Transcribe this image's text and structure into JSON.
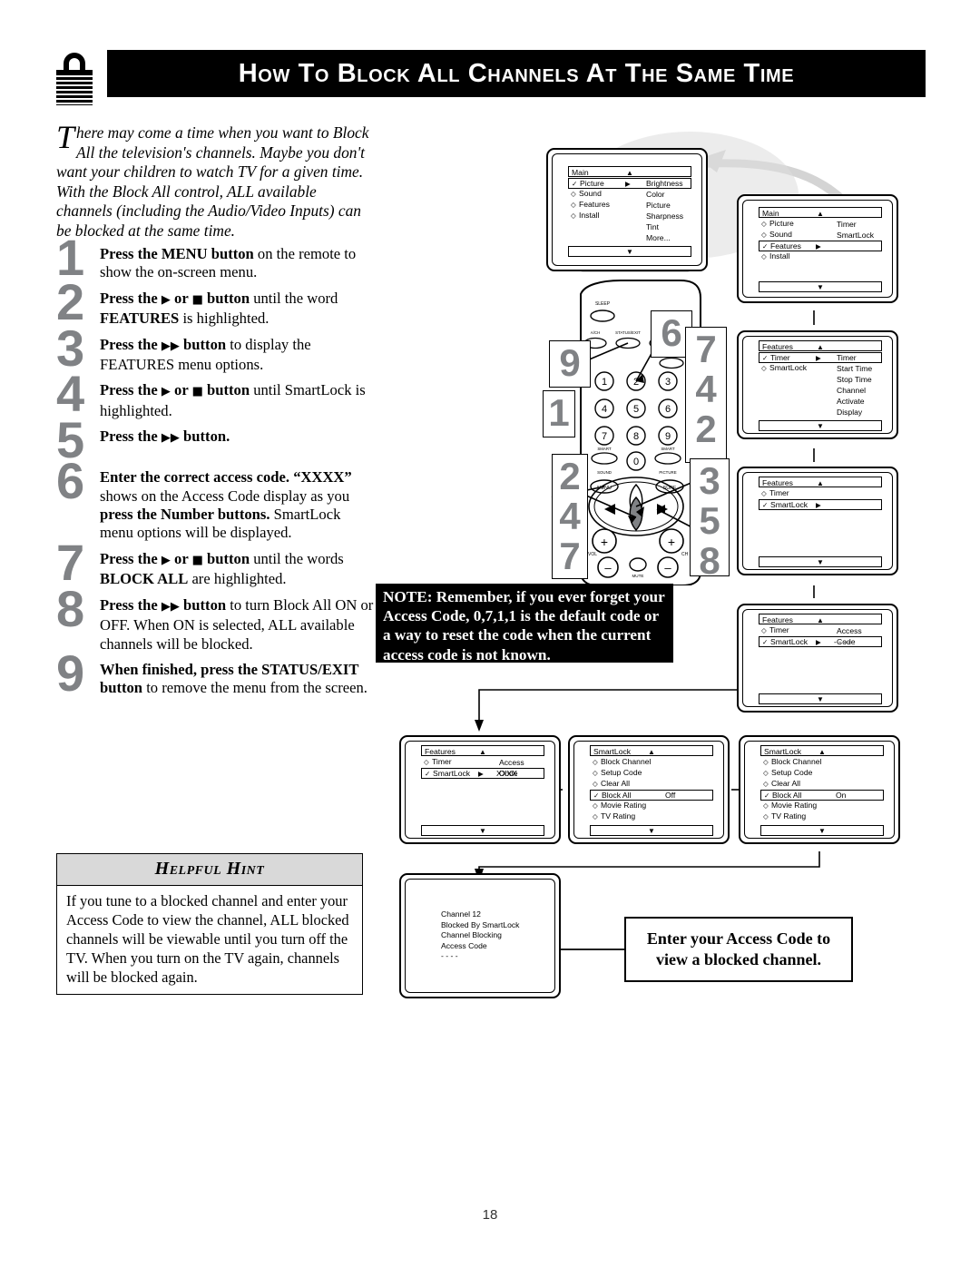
{
  "header": {
    "icon": "padlock-icon",
    "title": "How to Block All Channels at the Same Time"
  },
  "intro": {
    "dropcap": "T",
    "text": "here may come a time when you want to Block All the television's channels. Maybe you don't want your children to watch TV for a given time. With the Block All control, ALL available channels (including the Audio/Video Inputs) can be blocked at the same time."
  },
  "steps": [
    {
      "num": "1",
      "html": "<b>Press the MENU button</b> on the remote to show the on-screen menu."
    },
    {
      "num": "2",
      "html": "<b>Press the <span class='gl'>▶</span> or <span class='gl'>■</span> button</b> until the word <b>FEATURES</b> is highlighted."
    },
    {
      "num": "3",
      "html": "<b>Press the <span class='gl'>▶▶</span> button</b> to display the FEATURES menu options."
    },
    {
      "num": "4",
      "html": "<b>Press the <span class='gl'>▶</span> or <span class='gl'>■</span> button</b> until SmartLock is highlighted."
    },
    {
      "num": "5",
      "html": "<b>Press the <span class='gl'>▶▶</span> button.</b>"
    },
    {
      "num": "6",
      "html": "<b>Enter the correct access code.</b> <b>“XXXX”</b> shows on the Access Code display as you <b>press the Number buttons.</b> SmartLock menu options will be displayed."
    },
    {
      "num": "7",
      "html": "<b>Press the <span class='gl'>▶</span> or <span class='gl'>■</span> button</b> until the words <b>BLOCK ALL</b> are highlighted."
    },
    {
      "num": "8",
      "html": "<b>Press the <span class='gl'>▶▶</span> button</b> to turn Block All ON or OFF. When ON is selected, ALL available channels will be blocked."
    },
    {
      "num": "9",
      "html": "<b>When finished, press the STATUS/EXIT button</b> to remove the menu from the screen."
    }
  ],
  "hint": {
    "title": "Helpful Hint",
    "body": "If you tune to a blocked channel and enter your Access Code to view the channel, ALL blocked channels will be viewable until you turn off the TV. When you turn on the TV again, channels will be blocked again."
  },
  "note": {
    "text": "NOTE: Remember, if you ever forget your Access Code, 0,7,1,1 is the default code or a way to reset the code when the current access code is not known."
  },
  "access_callout": {
    "line1": "Enter your Access Code to",
    "line2": "view a blocked channel."
  },
  "screens": {
    "s1": {
      "header": "Main",
      "up": "▲",
      "down": "▼",
      "rows": [
        {
          "label": "Picture",
          "bullet": "✓",
          "selected": true,
          "arrow": "▶"
        },
        {
          "label": "Sound",
          "bullet": "◇",
          "selected": false,
          "arrow": ""
        },
        {
          "label": "Features",
          "bullet": "◇",
          "selected": false,
          "arrow": ""
        },
        {
          "label": "Install",
          "bullet": "◇",
          "selected": false,
          "arrow": ""
        }
      ],
      "col2": [
        "Brightness",
        "Color",
        "Picture",
        "Sharpness",
        "Tint",
        "More..."
      ]
    },
    "s2": {
      "header": "Main",
      "up": "▲",
      "down": "▼",
      "rows": [
        {
          "label": "Picture",
          "bullet": "◇",
          "selected": false,
          "arrow": ""
        },
        {
          "label": "Sound",
          "bullet": "◇",
          "selected": false,
          "arrow": ""
        },
        {
          "label": "Features",
          "bullet": "✓",
          "selected": true,
          "arrow": "▶"
        },
        {
          "label": "Install",
          "bullet": "◇",
          "selected": false,
          "arrow": ""
        }
      ],
      "col2": [
        "Timer",
        "SmartLock"
      ]
    },
    "s3": {
      "header": "Features",
      "up": "▲",
      "down": "▼",
      "rows": [
        {
          "label": "Timer",
          "bullet": "✓",
          "selected": true,
          "arrow": "▶"
        },
        {
          "label": "SmartLock",
          "bullet": "◇",
          "selected": false,
          "arrow": ""
        }
      ],
      "col2": [
        "Timer",
        "Start Time",
        "Stop Time",
        "Channel",
        "Activate",
        "Display"
      ]
    },
    "s4": {
      "header": "Features",
      "up": "▲",
      "down": "▼",
      "rows": [
        {
          "label": "Timer",
          "bullet": "◇",
          "selected": false,
          "arrow": ""
        },
        {
          "label": "SmartLock",
          "bullet": "✓",
          "selected": true,
          "arrow": "▶"
        }
      ],
      "col2": []
    },
    "s5": {
      "header": "Features",
      "up": "▲",
      "down": "▼",
      "rows": [
        {
          "label": "Timer",
          "bullet": "◇",
          "selected": false,
          "arrow": ""
        },
        {
          "label": "SmartLock",
          "bullet": "✓",
          "selected": true,
          "arrow": "▶",
          "value": "- - - -"
        }
      ],
      "col2": [
        "Access Code"
      ]
    },
    "s6": {
      "header": "Features",
      "up": "▲",
      "down": "▼",
      "rows": [
        {
          "label": "Timer",
          "bullet": "◇",
          "selected": false,
          "arrow": ""
        },
        {
          "label": "SmartLock",
          "bullet": "✓",
          "selected": true,
          "arrow": "▶",
          "value": "XXXX"
        }
      ],
      "col2": [
        "Access Code"
      ]
    },
    "s7": {
      "header": "SmartLock",
      "up": "▲",
      "down": "▼",
      "rows": [
        {
          "label": "Block Channel",
          "bullet": "◇",
          "selected": false
        },
        {
          "label": "Setup Code",
          "bullet": "◇",
          "selected": false
        },
        {
          "label": "Clear All",
          "bullet": "◇",
          "selected": false
        },
        {
          "label": "Block All",
          "bullet": "✓",
          "selected": true,
          "value": "Off"
        },
        {
          "label": "Movie Rating",
          "bullet": "◇",
          "selected": false
        },
        {
          "label": "TV Rating",
          "bullet": "◇",
          "selected": false
        }
      ],
      "col2": []
    },
    "s8": {
      "header": "SmartLock",
      "up": "▲",
      "down": "▼",
      "rows": [
        {
          "label": "Block Channel",
          "bullet": "◇",
          "selected": false
        },
        {
          "label": "Setup Code",
          "bullet": "◇",
          "selected": false
        },
        {
          "label": "Clear All",
          "bullet": "◇",
          "selected": false
        },
        {
          "label": "Block All",
          "bullet": "✓",
          "selected": true,
          "value": "On"
        },
        {
          "label": "Movie Rating",
          "bullet": "◇",
          "selected": false
        },
        {
          "label": "TV Rating",
          "bullet": "◇",
          "selected": false
        }
      ],
      "col2": []
    },
    "s9": {
      "lines": [
        "Channel 12",
        "Blocked By SmartLock",
        "Channel Blocking",
        "Access Code",
        "- - - -"
      ]
    }
  },
  "remote": {
    "labels": {
      "sleep": "SLEEP",
      "ach": "A/CH",
      "status_exit": "STATUS/EXIT",
      "clock": "CLOCK",
      "tvvcr": "TV/VCR",
      "menu": "MENU",
      "surf": "SURF",
      "mute": "MUTE",
      "vol": "VOL",
      "ch": "CH",
      "smart_sound": "SMART SOUND",
      "smart_picture": "SMART PICTURE"
    },
    "keypad": [
      "1",
      "2",
      "3",
      "4",
      "5",
      "6",
      "7",
      "8",
      "9",
      "0"
    ],
    "callouts": [
      "6",
      "9",
      "1",
      "7",
      "4",
      "2",
      "2",
      "4",
      "7",
      "3",
      "5",
      "8"
    ]
  },
  "page_number": "18"
}
